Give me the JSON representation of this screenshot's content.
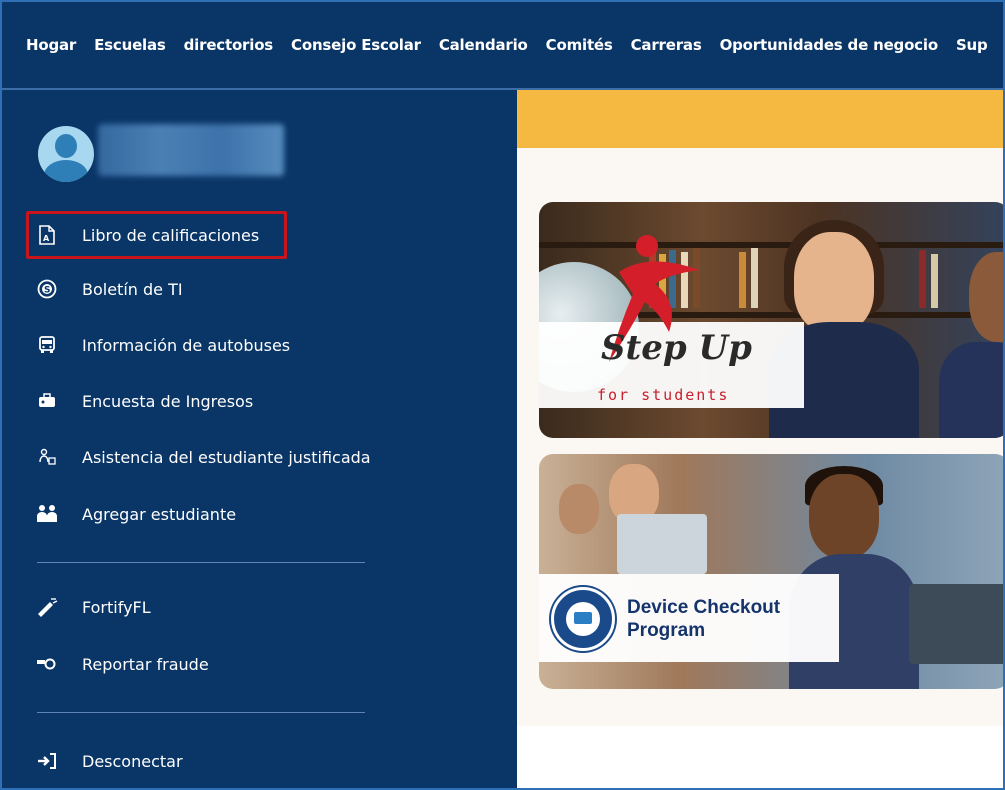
{
  "nav": {
    "items": [
      "Hogar",
      "Escuelas",
      "directorios",
      "Consejo Escolar",
      "Calendario",
      "Comités",
      "Carreras",
      "Oportunidades de negocio",
      "Sup"
    ]
  },
  "sidebar": {
    "user": {
      "avatar": "user-avatar-icon"
    },
    "items": [
      {
        "label": "Libro de calificaciones",
        "icon": "gradebook-icon"
      },
      {
        "label": "Boletín de TI",
        "icon": "bulletin-icon"
      },
      {
        "label": "Información de autobuses",
        "icon": "bus-icon"
      },
      {
        "label": "Encuesta de Ingresos",
        "icon": "income-survey-icon"
      },
      {
        "label": "Asistencia del estudiante justificada",
        "icon": "attendance-icon"
      },
      {
        "label": "Agregar estudiante",
        "icon": "add-student-icon"
      }
    ],
    "secondary": [
      {
        "label": "FortifyFL",
        "icon": "megaphone-icon"
      },
      {
        "label": "Reportar fraude",
        "icon": "whistle-icon"
      }
    ],
    "logout": {
      "label": "Desconectar",
      "icon": "sign-out-icon"
    }
  },
  "main": {
    "card1": {
      "script_title": "Step Up",
      "subtitle": "for students"
    },
    "card2": {
      "title_line1": "Device Checkout",
      "title_line2": "Program"
    }
  },
  "colors": {
    "nav_bg": "#0a3567",
    "accent_band": "#f5b942",
    "highlight": "#c8141b",
    "stepup_red": "#c8202c",
    "device_blue": "#15346b"
  }
}
